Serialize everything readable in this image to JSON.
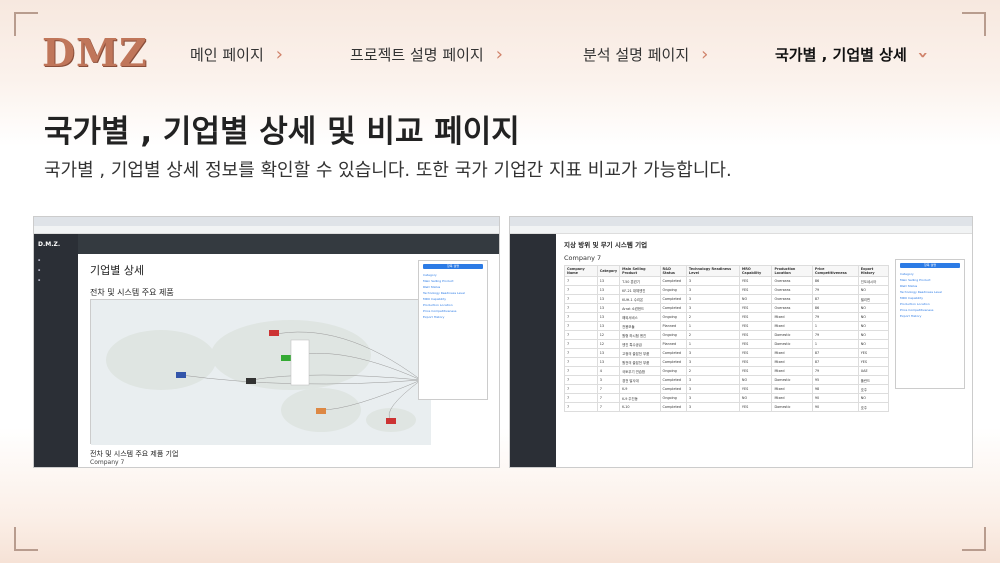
{
  "logo": "DMZ",
  "nav": [
    {
      "label": "메인 페이지"
    },
    {
      "label": "프로젝트 설명 페이지"
    },
    {
      "label": "분석 설명 페이지"
    },
    {
      "label": "국가별 , 기업별 상세"
    }
  ],
  "headline": "국가별 , 기업별 상세 및 비교 페이지",
  "subtitle": "국가별 , 기업별 상세 정보를 확인할 수 있습니다. 또한 국가 기업간 지표 비교가 가능합니다.",
  "left_shot": {
    "brand": "D.M.Z.",
    "title": "기업별 상세",
    "section": "전차 및 시스템 주요 제품",
    "bottom_section": "전차 및 시스템 주요 제품 기업",
    "company": "Company 7"
  },
  "right_shot": {
    "heading": "지상 방위 및 무기 시스템 기업",
    "company": "Company 7",
    "columns": [
      "Company Name",
      "Category",
      "Main Selling Product",
      "R&D Status",
      "Technology Readiness Level",
      "MRO Capability",
      "Production Location",
      "Price Competitiveness",
      "Export History"
    ],
    "rows": [
      [
        "7",
        "13",
        "T-50 훈련기",
        "Completed",
        "3",
        "YES",
        "Overseas",
        "86",
        "인도네시아"
      ],
      [
        "7",
        "13",
        "KF-21 대체엔진",
        "Ongoing",
        "3",
        "YES",
        "Overseas",
        "79",
        "NO"
      ],
      [
        "7",
        "13",
        "KUH-1 수리온",
        "Completed",
        "3",
        "NO",
        "Overseas",
        "87",
        "필리핀"
      ],
      [
        "7",
        "13",
        "Arrat 소련헌드",
        "Completed",
        "3",
        "YES",
        "Overseas",
        "86",
        "NO"
      ],
      [
        "7",
        "13",
        "해외서비스",
        "Ongoing",
        "2",
        "YES",
        "Mixed",
        "79",
        "NO"
      ],
      [
        "7",
        "13",
        "전용모듈",
        "Planned",
        "1",
        "YES",
        "Mixed",
        "1",
        "NO"
      ],
      [
        "7",
        "12",
        "원형 하시험 엔진",
        "Ongoing",
        "2",
        "YES",
        "Domestic",
        "79",
        "NO"
      ],
      [
        "7",
        "12",
        "엔진 특수공급",
        "Planned",
        "1",
        "YES",
        "Domestic",
        "1",
        "NO"
      ],
      [
        "7",
        "13",
        "고정의 출잡전 부품",
        "Completed",
        "3",
        "YES",
        "Mixed",
        "87",
        "YES"
      ],
      [
        "7",
        "13",
        "원전의 출잡전 부품",
        "Completed",
        "3",
        "YES",
        "Mixed",
        "87",
        "YES"
      ],
      [
        "7",
        "4",
        "국토무기 연습함",
        "Ongoing",
        "2",
        "YES",
        "Mixed",
        "79",
        "UAE"
      ],
      [
        "7",
        "3",
        "경전 발사대",
        "Completed",
        "3",
        "NO",
        "Domestic",
        "95",
        "폴란드"
      ],
      [
        "7",
        "7",
        "K-9",
        "Completed",
        "3",
        "YES",
        "Mixed",
        "98",
        "호주"
      ],
      [
        "7",
        "7",
        "K-9 주진동",
        "Ongoing",
        "3",
        "NO",
        "Mixed",
        "90",
        "NO"
      ],
      [
        "7",
        "7",
        "K-10",
        "Completed",
        "3",
        "YES",
        "Domestic",
        "90",
        "호주"
      ]
    ]
  },
  "panel_button": "항목 설명",
  "panel_items": [
    "Category",
    "Main Selling Product",
    "R&D Status",
    "Technology Readiness Level",
    "MRO Capability",
    "Production Location",
    "Price Competitiveness",
    "Export History"
  ],
  "colors": {
    "accent": "#d0826a",
    "link": "#2c7be5",
    "sidebar": "#2b2f36"
  }
}
